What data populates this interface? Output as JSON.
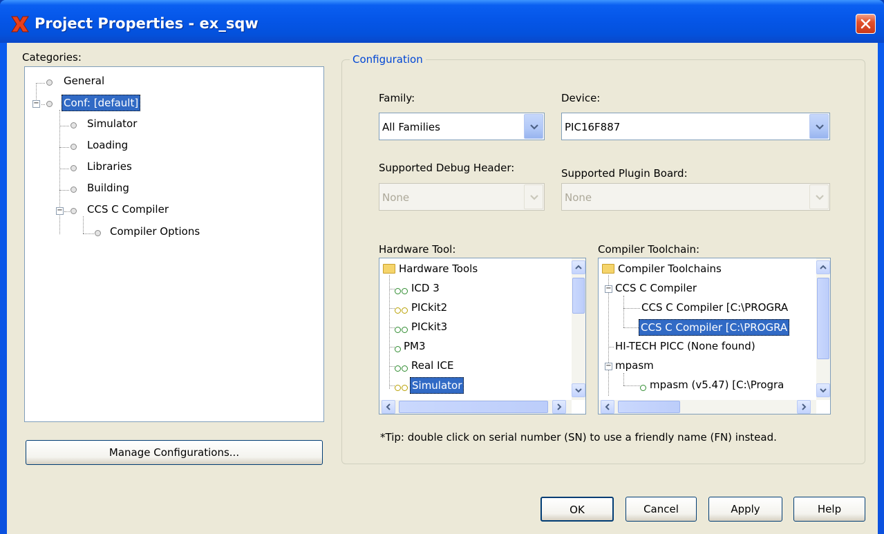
{
  "window": {
    "title": "Project Properties - ex_sqw"
  },
  "categories": {
    "label": "Categories:",
    "items": [
      {
        "label": "General"
      },
      {
        "label": "Conf: [default]"
      },
      {
        "label": "Simulator"
      },
      {
        "label": "Loading"
      },
      {
        "label": "Libraries"
      },
      {
        "label": "Building"
      },
      {
        "label": "CCS C Compiler"
      },
      {
        "label": "Compiler Options"
      }
    ],
    "manage_button": "Manage Configurations..."
  },
  "configuration": {
    "legend": "Configuration",
    "family_label": "Family:",
    "family_value": "All Families",
    "device_label": "Device:",
    "device_value": "PIC16F887",
    "debug_header_label": "Supported Debug Header:",
    "debug_header_value": "None",
    "plugin_board_label": "Supported Plugin Board:",
    "plugin_board_value": "None",
    "hardware_tool_label": "Hardware Tool:",
    "hardware_tools": {
      "root": "Hardware Tools",
      "items": [
        {
          "label": "ICD 3",
          "status": "green"
        },
        {
          "label": "PICkit2",
          "status": "yellow"
        },
        {
          "label": "PICkit3",
          "status": "green"
        },
        {
          "label": "PM3",
          "status": "green"
        },
        {
          "label": "Real ICE",
          "status": "green"
        },
        {
          "label": "Simulator",
          "status": "yellow"
        }
      ]
    },
    "compiler_toolchain_label": "Compiler Toolchain:",
    "compiler_toolchains": {
      "root": "Compiler Toolchains",
      "items": [
        {
          "label": "CCS C Compiler"
        },
        {
          "label": "CCS C Compiler [C:\\PROGRA"
        },
        {
          "label": "CCS C Compiler [C:\\PROGRA"
        },
        {
          "label": "HI-TECH PICC (None found)"
        },
        {
          "label": "mpasm"
        },
        {
          "label": "mpasm (v5.47) [C:\\Progra"
        }
      ]
    },
    "tip": "*Tip: double click on serial number (SN) to use a friendly name (FN) instead."
  },
  "buttons": {
    "ok": "OK",
    "cancel": "Cancel",
    "apply": "Apply",
    "help": "Help"
  },
  "colors": {
    "selection": "#316ac5",
    "titlebar": "#0556e8",
    "legend": "#0046d5"
  }
}
